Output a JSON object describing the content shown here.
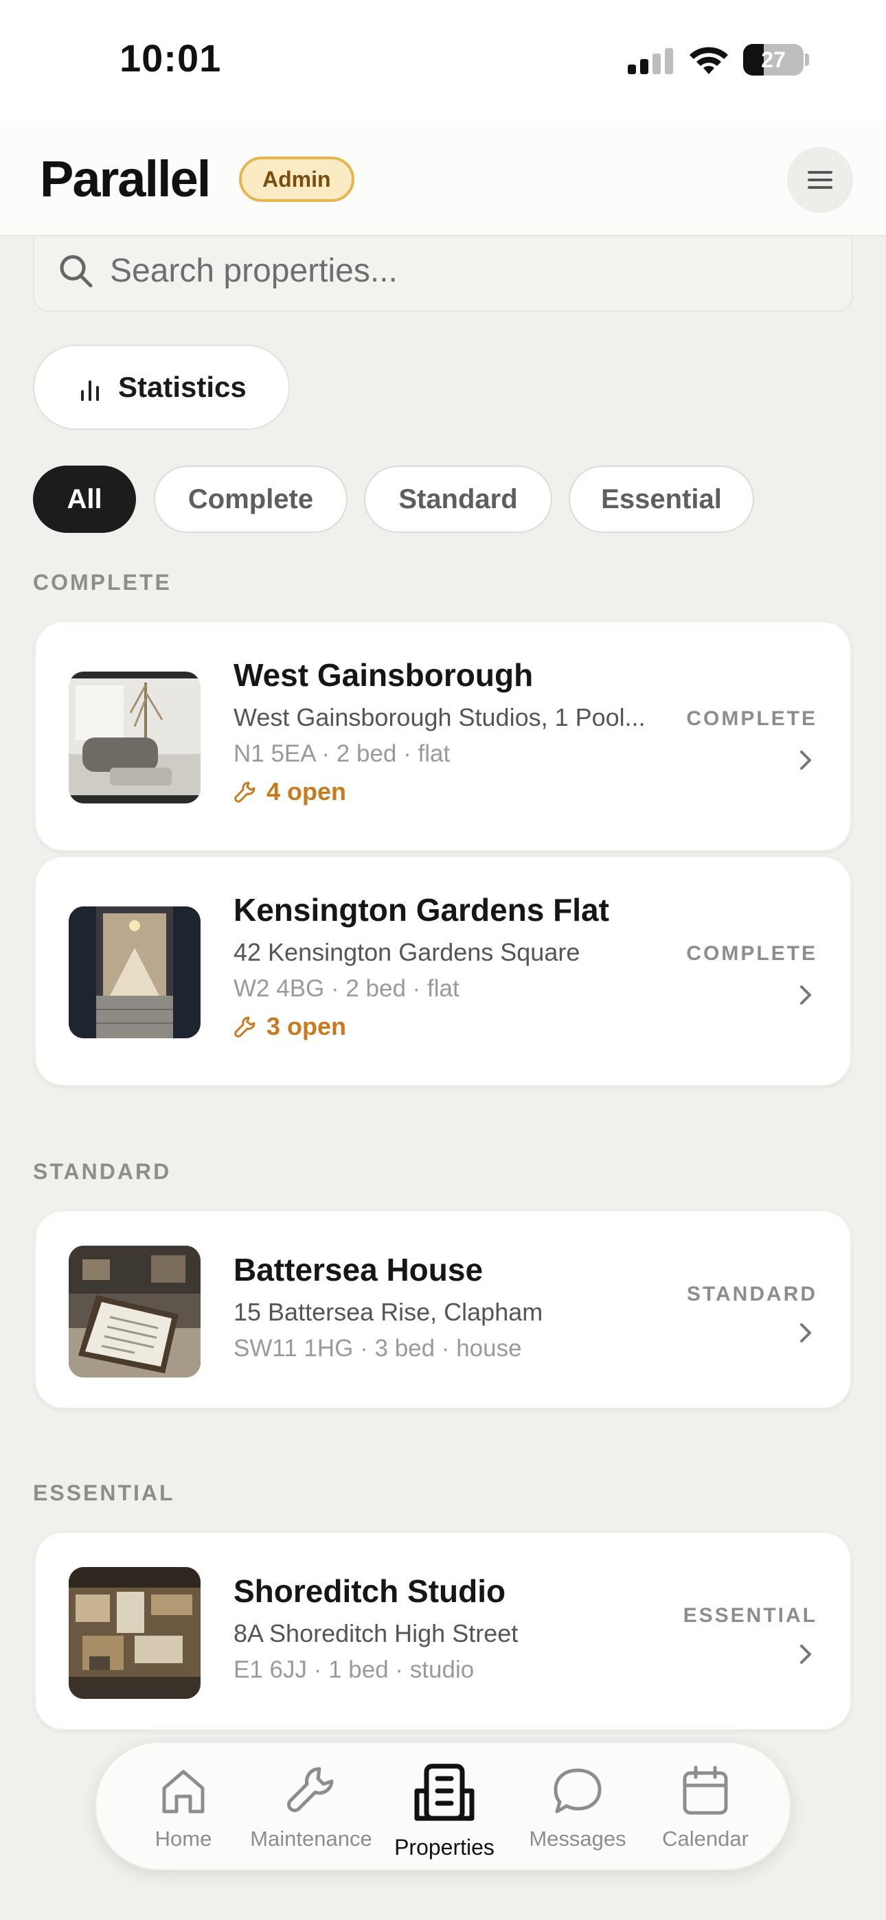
{
  "status_bar": {
    "time": "10:01",
    "battery": "27"
  },
  "header": {
    "logo": "Parallel",
    "badge": "Admin",
    "menu_icon": "hamburger-icon"
  },
  "search": {
    "placeholder": "Search properties..."
  },
  "statistics": {
    "label": "Statistics"
  },
  "filters": [
    {
      "label": "All",
      "active": true
    },
    {
      "label": "Complete",
      "active": false
    },
    {
      "label": "Standard",
      "active": false
    },
    {
      "label": "Essential",
      "active": false
    }
  ],
  "sections": [
    {
      "label": "COMPLETE"
    },
    {
      "label": "STANDARD"
    },
    {
      "label": "ESSENTIAL"
    }
  ],
  "properties": [
    {
      "name": "West Gainsborough",
      "address": "West Gainsborough Studios, 1 Pool...",
      "meta": "N1 5EA · 2 bed · flat",
      "open": "4 open",
      "tier": "COMPLETE"
    },
    {
      "name": "Kensington Gardens Flat",
      "address": "42 Kensington Gardens Square",
      "meta": "W2 4BG · 2 bed · flat",
      "open": "3 open",
      "tier": "COMPLETE"
    },
    {
      "name": "Battersea House",
      "address": "15 Battersea Rise, Clapham",
      "meta": "SW11 1HG · 3 bed · house",
      "tier": "STANDARD"
    },
    {
      "name": "Shoreditch Studio",
      "address": "8A Shoreditch High Street",
      "meta": "E1 6JJ · 1 bed · studio",
      "tier": "ESSENTIAL"
    }
  ],
  "nav": [
    {
      "label": "Home",
      "icon": "home-icon"
    },
    {
      "label": "Maintenance",
      "icon": "wrench-icon"
    },
    {
      "label": "Properties",
      "icon": "building-icon",
      "active": true
    },
    {
      "label": "Messages",
      "icon": "chat-bubble-icon"
    },
    {
      "label": "Calendar",
      "icon": "calendar-icon"
    }
  ],
  "colors": {
    "accent_orange": "#C97A1E",
    "badge_bg": "#FBEBC4",
    "badge_border": "#E5B54F",
    "background": "#F1F0EC",
    "active_pill": "#1C1C1C"
  }
}
